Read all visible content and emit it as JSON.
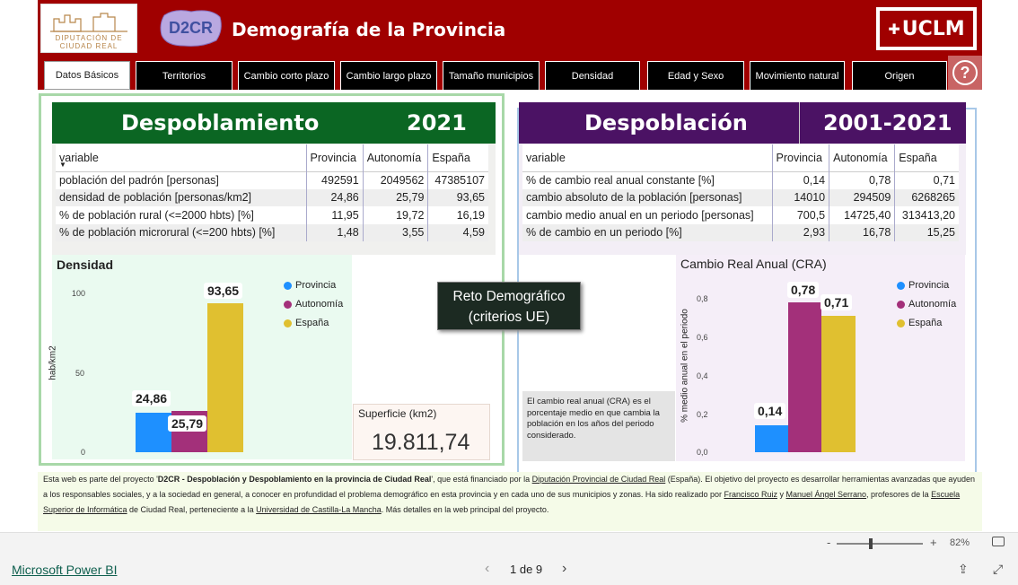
{
  "header": {
    "title": "Demografía de la Provincia",
    "logo_diputacion_text": "DIPUTACIÓN DE CIUDAD REAL",
    "logo_d2cr_text": "D2CR",
    "logo_uclm_text": "UCLM"
  },
  "tabs": [
    {
      "label": "Datos Básicos",
      "active": true
    },
    {
      "label": "Territorios"
    },
    {
      "label": "Cambio corto plazo"
    },
    {
      "label": "Cambio largo plazo"
    },
    {
      "label": "Tamaño municipios"
    },
    {
      "label": "Densidad"
    },
    {
      "label": "Edad y Sexo"
    },
    {
      "label": "Movimiento natural"
    },
    {
      "label": "Origen"
    }
  ],
  "help_label": "?",
  "left_panel": {
    "title": "Despoblamiento",
    "year": "2021",
    "columns": [
      "variable",
      "Provincia",
      "Autonomía",
      "España"
    ],
    "rows": [
      [
        "población del padrón [personas]",
        "492591",
        "2049562",
        "47385107"
      ],
      [
        "densidad de población [personas/km2]",
        "24,86",
        "25,79",
        "93,65"
      ],
      [
        "% de población rural (<=2000 hbts) [%]",
        "11,95",
        "19,72",
        "16,19"
      ],
      [
        "% de población microrural (<=200 hbts) [%]",
        "1,48",
        "3,55",
        "4,59"
      ]
    ]
  },
  "right_panel": {
    "title": "Despoblación",
    "year": "2001-2021",
    "columns": [
      "variable",
      "Provincia",
      "Autonomía",
      "España"
    ],
    "rows": [
      [
        "% de cambio real anual constante [%]",
        "0,14",
        "0,78",
        "0,71"
      ],
      [
        "cambio absoluto de la población [personas]",
        "14010",
        "294509",
        "6268265"
      ],
      [
        "cambio medio anual en un periodo [personas]",
        "700,5",
        "14725,40",
        "313413,20"
      ],
      [
        "% de cambio en un periodo [%]",
        "2,93",
        "16,78",
        "15,25"
      ]
    ]
  },
  "colors": {
    "provincia": "#1e90ff",
    "autonomia": "#a3307a",
    "espana": "#e0c030",
    "brand": "#a00000",
    "green": "#0b6623",
    "purple": "#4b1264"
  },
  "density_chart": {
    "title": "Densidad",
    "ylabel": "hab/km2",
    "ticks": [
      "100",
      "50",
      "0"
    ],
    "legend": [
      "Provincia",
      "Autonomía",
      "España"
    ],
    "labels": [
      "24,86",
      "25,79",
      "93,65"
    ]
  },
  "reto_button": {
    "line1": "Reto Demográfico",
    "line2": "(criterios UE)"
  },
  "superficie": {
    "label": "Superficie (km2)",
    "value": "19.811,74"
  },
  "cra_chart": {
    "title": "Cambio Real Anual (CRA)",
    "ylabel": "% medio anual en el periodo",
    "ticks": [
      "0,8",
      "0,6",
      "0,4",
      "0,2",
      "0,0"
    ],
    "legend": [
      "Provincia",
      "Autonomía",
      "España"
    ],
    "labels": [
      "0,14",
      "0,78",
      "0,71"
    ]
  },
  "cra_note": "El cambio real anual (CRA) es el porcentaje medio en que cambia la población en los años del periodo considerado.",
  "chart_data": [
    {
      "type": "bar",
      "title": "Densidad",
      "ylabel": "hab/km2",
      "categories": [
        "Provincia",
        "Autonomía",
        "España"
      ],
      "values": [
        24.86,
        25.79,
        93.65
      ],
      "ylim": [
        0,
        100
      ]
    },
    {
      "type": "bar",
      "title": "Cambio Real Anual (CRA)",
      "ylabel": "% medio anual en el periodo",
      "categories": [
        "Provincia",
        "Autonomía",
        "España"
      ],
      "values": [
        0.14,
        0.78,
        0.71
      ],
      "ylim": [
        0,
        0.8
      ]
    }
  ],
  "footer": {
    "p1": "Esta web es parte del proyecto '",
    "project": "D2CR - Despoblación y Despoblamiento en la provincia de Ciudad Real",
    "p2": "', que está financiado por la ",
    "link_diputacion": "Diputación Provincial de Ciudad Real",
    "p3": " (España).  El objetivo del proyecto es desarrollar herramientas avanzadas que ayuden a los responsables sociales, y a la sociedad en general, a conocer en profundidad el problema demográfico en esta provincia y en cada uno de sus municipios y zonas. Ha sido realizado por ",
    "link_ruiz": "Francisco Ruiz",
    "p4": " y ",
    "link_serrano": "Manuel Ángel Serrano",
    "p5": ", profesores de la ",
    "link_esi": "Escuela Superior de Informática",
    "p6": " de Ciudad Real, perteneciente a la ",
    "link_uclm": "Universidad de Castilla-La Mancha",
    "p7": ". Más detalles en la web principal del proyecto."
  },
  "zoom": {
    "minus": "-",
    "plus": "+",
    "level": "82%",
    "value": 82
  },
  "status": {
    "brand": "Microsoft Power BI",
    "page": "1 de 9"
  }
}
